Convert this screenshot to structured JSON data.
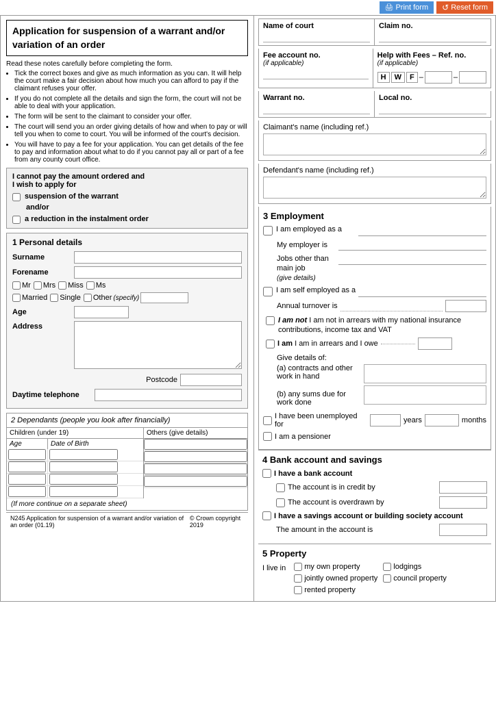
{
  "topbar": {
    "print_label": "Print form",
    "reset_label": "Reset form"
  },
  "left": {
    "title": "Application for suspension of a warrant and/or variation of an order",
    "instructions_intro": "Read these notes carefully before completing the form.",
    "instructions": [
      "Tick the correct boxes and give as much information as you can. It will help the court make a fair decision about how much you can afford to pay if the claimant refuses your offer.",
      "If you do not complete all the details and sign the form, the court will not be able to deal with your application.",
      "The form will be sent to the claimant to consider your offer.",
      "The court will send you an order giving details of how and when to pay or will tell you when to come to court. You will be informed of the court's decision.",
      "You will have to pay a fee for your application. You can get details of the fee to pay and information about what to do if you cannot pay all or part of a fee from any county court office."
    ],
    "cannot_pay": "I cannot pay the amount ordered and",
    "wish_to_apply": "I wish to apply for",
    "suspension_label": "suspension of the warrant",
    "andor_label": "and/or",
    "reduction_label": "a reduction in the instalment order",
    "section1_title": "1 Personal details",
    "surname_label": "Surname",
    "forename_label": "Forename",
    "title_mr": "Mr",
    "title_mrs": "Mrs",
    "title_miss": "Miss",
    "title_ms": "Ms",
    "title_married": "Married",
    "title_single": "Single",
    "title_other": "Other",
    "title_other_specify": "(specify)",
    "age_label": "Age",
    "address_label": "Address",
    "postcode_label": "Postcode",
    "daytime_label": "Daytime telephone",
    "section2_title": "2 Dependants",
    "section2_sub": "(people you look after financially)",
    "children_header": "Children (under 19)",
    "others_header": "Others (give details)",
    "age_col": "Age",
    "dob_col": "Date of Birth",
    "continue_note": "(If more continue on a separate sheet)"
  },
  "right": {
    "name_of_court_label": "Name of court",
    "claim_no_label": "Claim no.",
    "fee_account_label": "Fee account no.",
    "fee_account_sub": "(if applicable)",
    "help_fees_label": "Help with Fees – Ref. no.",
    "help_fees_sub": "(if applicable)",
    "hwf_h": "H",
    "hwf_w": "W",
    "hwf_f": "F",
    "warrant_no_label": "Warrant no.",
    "local_no_label": "Local no.",
    "claimant_label": "Claimant's name",
    "claimant_sub": "(including ref.)",
    "defendant_label": "Defendant's name",
    "defendant_sub": "(including ref.)",
    "section3_title": "3 Employment",
    "employed_label": "I am employed as a",
    "employer_label": "My employer is",
    "jobs_label": "Jobs other than main job",
    "jobs_give": "(give details)",
    "self_employed_label": "I am self employed as a",
    "annual_turnover": "Annual turnover is",
    "not_arrears_label": "I am not in arrears with my national insurance contributions, income tax and VAT",
    "am_arrears_label": "I am in arrears and I owe",
    "give_details": "Give details of:",
    "contracts_a": "(a) contracts and other work in hand",
    "sums_b": "(b) any sums due for work done",
    "unemployed_label": "I have been unemployed for",
    "years_label": "years",
    "months_label": "months",
    "pensioner_label": "I am a pensioner",
    "section4_title": "4 Bank account and savings",
    "bank_account_label": "I have a bank account",
    "credit_label": "The account is in credit by",
    "overdrawn_label": "The account is overdrawn by",
    "savings_label": "I have a savings account or building society account",
    "savings_amount_label": "The amount in the account is",
    "section5_title": "5 Property",
    "live_in_label": "I live in",
    "own_property": "my own property",
    "jointly_owned": "jointly owned property",
    "rented_property": "rented property",
    "lodgings": "lodgings",
    "council_property": "council property",
    "pound_symbol": "£"
  },
  "footer": {
    "left": "N245 Application for suspension of a warrant and/or variation of an order (01.19)",
    "right": "© Crown copyright 2019"
  }
}
